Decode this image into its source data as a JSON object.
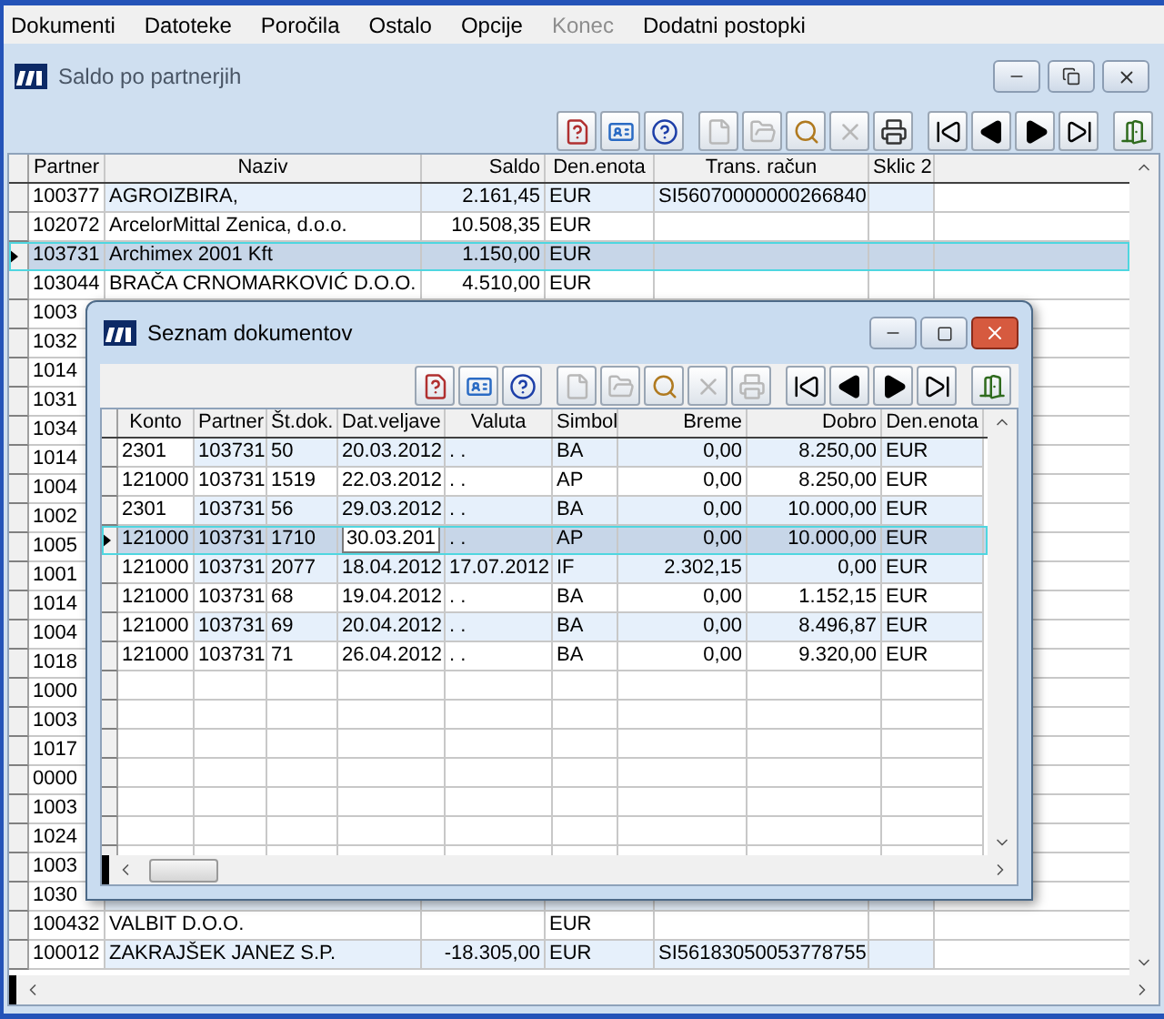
{
  "menu": [
    {
      "label": "Dokumenti",
      "disabled": false
    },
    {
      "label": "Datoteke",
      "disabled": false
    },
    {
      "label": "Poročila",
      "disabled": false
    },
    {
      "label": "Ostalo",
      "disabled": false
    },
    {
      "label": "Opcije",
      "disabled": false
    },
    {
      "label": "Konec",
      "disabled": true
    },
    {
      "label": "Dodatni postopki",
      "disabled": false
    }
  ],
  "main_window": {
    "title": "Saldo po partnerjih",
    "toolbar": [
      {
        "kind": "help-book",
        "disabled": false
      },
      {
        "kind": "card",
        "disabled": false
      },
      {
        "kind": "help",
        "disabled": false
      },
      {
        "kind": "new",
        "disabled": true
      },
      {
        "kind": "open",
        "disabled": true
      },
      {
        "kind": "search",
        "disabled": false
      },
      {
        "kind": "delete",
        "disabled": true
      },
      {
        "kind": "print",
        "disabled": false
      },
      {
        "kind": "first",
        "disabled": false
      },
      {
        "kind": "prev",
        "disabled": false
      },
      {
        "kind": "next",
        "disabled": false
      },
      {
        "kind": "last",
        "disabled": false
      },
      {
        "kind": "exit",
        "disabled": false
      }
    ],
    "columns": [
      "Partner",
      "Naziv",
      "Saldo",
      "Den.enota",
      "Trans. račun",
      "Sklic 2"
    ],
    "rows": [
      {
        "cells": [
          "100377",
          "AGROIZBIRA,",
          "2.161,45",
          "EUR",
          "SI56070000000266840",
          ""
        ],
        "selected": false
      },
      {
        "cells": [
          "102072",
          "ArcelorMittal Zenica, d.o.o.",
          "10.508,35",
          "EUR",
          "",
          ""
        ],
        "selected": false
      },
      {
        "cells": [
          "103731",
          "Archimex 2001 Kft",
          "1.150,00",
          "EUR",
          "",
          ""
        ],
        "selected": true
      },
      {
        "cells": [
          "103044",
          "BRAČA CRNOMARKOVIĆ D.O.O.",
          "4.510,00",
          "EUR",
          "",
          ""
        ],
        "selected": false
      },
      {
        "cells": [
          "1003"
        ],
        "selected": false
      },
      {
        "cells": [
          "1032"
        ],
        "selected": false
      },
      {
        "cells": [
          "1014"
        ],
        "selected": false
      },
      {
        "cells": [
          "1031"
        ],
        "selected": false
      },
      {
        "cells": [
          "1034"
        ],
        "selected": false
      },
      {
        "cells": [
          "1014"
        ],
        "selected": false
      },
      {
        "cells": [
          "1004"
        ],
        "selected": false
      },
      {
        "cells": [
          "1002"
        ],
        "selected": false
      },
      {
        "cells": [
          "1005"
        ],
        "selected": false
      },
      {
        "cells": [
          "1001"
        ],
        "selected": false
      },
      {
        "cells": [
          "1014"
        ],
        "selected": false
      },
      {
        "cells": [
          "1004"
        ],
        "selected": false
      },
      {
        "cells": [
          "1018"
        ],
        "selected": false
      },
      {
        "cells": [
          "1000"
        ],
        "selected": false
      },
      {
        "cells": [
          "1003"
        ],
        "selected": false
      },
      {
        "cells": [
          "1017"
        ],
        "selected": false
      },
      {
        "cells": [
          "0000"
        ],
        "selected": false
      },
      {
        "cells": [
          "1003"
        ],
        "selected": false
      },
      {
        "cells": [
          "1024"
        ],
        "selected": false
      },
      {
        "cells": [
          "1003"
        ],
        "selected": false
      },
      {
        "cells": [
          "1030"
        ],
        "selected": false
      },
      {
        "cells": [
          "100432",
          "VALBIT D.O.O.",
          "",
          "EUR",
          "",
          ""
        ],
        "selected": false
      },
      {
        "cells": [
          "100012",
          "ZAKRAJŠEK JANEZ S.P.",
          "-18.305,00",
          "EUR",
          "SI56183050053778755",
          ""
        ],
        "selected": false
      }
    ]
  },
  "dialog": {
    "title": "Seznam dokumentov",
    "toolbar": [
      {
        "kind": "help-book",
        "disabled": false
      },
      {
        "kind": "card",
        "disabled": false
      },
      {
        "kind": "help",
        "disabled": false
      },
      {
        "kind": "new",
        "disabled": true
      },
      {
        "kind": "open",
        "disabled": true
      },
      {
        "kind": "search",
        "disabled": false
      },
      {
        "kind": "delete",
        "disabled": true
      },
      {
        "kind": "print",
        "disabled": true
      },
      {
        "kind": "first",
        "disabled": false
      },
      {
        "kind": "prev",
        "disabled": false
      },
      {
        "kind": "next",
        "disabled": false
      },
      {
        "kind": "last",
        "disabled": false
      },
      {
        "kind": "exit",
        "disabled": false
      }
    ],
    "columns": [
      "Konto",
      "Partner",
      "Št.dok.",
      "Dat.veljave",
      "Valuta",
      "Simbol",
      "Breme",
      "Dobro",
      "Den.enota"
    ],
    "rows": [
      {
        "cells": [
          "2301",
          "103731",
          "50",
          "20.03.2012",
          ". .",
          "BA",
          "0,00",
          "8.250,00",
          "EUR"
        ],
        "selected": false
      },
      {
        "cells": [
          "121000",
          "103731",
          "1519",
          "22.03.2012",
          ". .",
          "AP",
          "0,00",
          "8.250,00",
          "EUR"
        ],
        "selected": false
      },
      {
        "cells": [
          "2301",
          "103731",
          "56",
          "29.03.2012",
          ". .",
          "BA",
          "0,00",
          "10.000,00",
          "EUR"
        ],
        "selected": false
      },
      {
        "cells": [
          "121000",
          "103731",
          "1710",
          "30.03.201",
          ". .",
          "AP",
          "0,00",
          "10.000,00",
          "EUR"
        ],
        "selected": true
      },
      {
        "cells": [
          "121000",
          "103731",
          "2077",
          "18.04.2012",
          "17.07.2012",
          "IF",
          "2.302,15",
          "0,00",
          "EUR"
        ],
        "selected": false
      },
      {
        "cells": [
          "121000",
          "103731",
          "68",
          "19.04.2012",
          ". .",
          "BA",
          "0,00",
          "1.152,15",
          "EUR"
        ],
        "selected": false
      },
      {
        "cells": [
          "121000",
          "103731",
          "69",
          "20.04.2012",
          ". .",
          "BA",
          "0,00",
          "8.496,87",
          "EUR"
        ],
        "selected": false
      },
      {
        "cells": [
          "121000",
          "103731",
          "71",
          "26.04.2012",
          ". .",
          "BA",
          "0,00",
          "9.320,00",
          "EUR"
        ],
        "selected": false
      }
    ]
  }
}
